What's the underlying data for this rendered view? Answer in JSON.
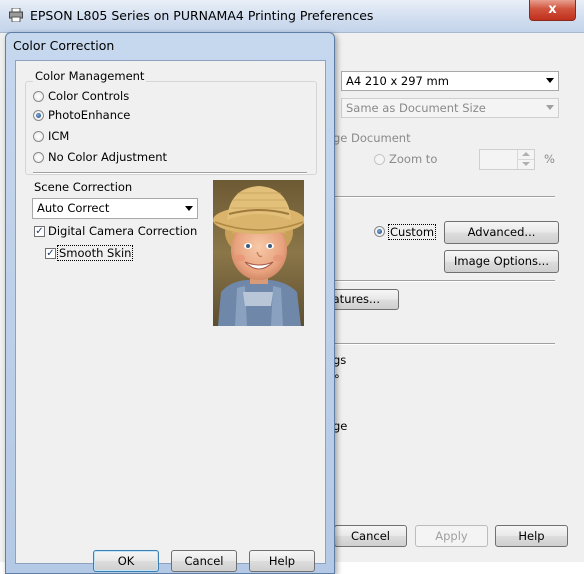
{
  "main_window": {
    "title": "EPSON L805 Series on PURNAMA4 Printing Preferences",
    "close_label": "x",
    "paper_size": "A4 210 x 297 mm",
    "output_paper": "Same as Document Size",
    "reduce_enlarge_fragment": "ge Document",
    "zoom_to_label": "Zoom to",
    "zoom_unit": "%",
    "custom_label": "Custom",
    "advanced_button": "Advanced...",
    "image_options_button": "Image Options...",
    "features_button_fragment": "eatures...",
    "fragment_gs": "gs",
    "fragment_degree": "°",
    "fragment_ge": "ge",
    "footer": {
      "cancel": "Cancel",
      "apply": "Apply",
      "help": "Help"
    }
  },
  "dialog": {
    "title": "Color Correction",
    "color_management": {
      "label": "Color Management",
      "options": [
        "Color Controls",
        "PhotoEnhance",
        "ICM",
        "No Color Adjustment"
      ],
      "selected": "PhotoEnhance"
    },
    "scene_correction": {
      "label": "Scene Correction",
      "value": "Auto Correct"
    },
    "digital_camera_correction": {
      "label": "Digital Camera Correction",
      "checked": true
    },
    "smooth_skin": {
      "label": "Smooth Skin",
      "checked": true
    },
    "buttons": {
      "ok": "OK",
      "cancel": "Cancel",
      "help": "Help"
    }
  }
}
